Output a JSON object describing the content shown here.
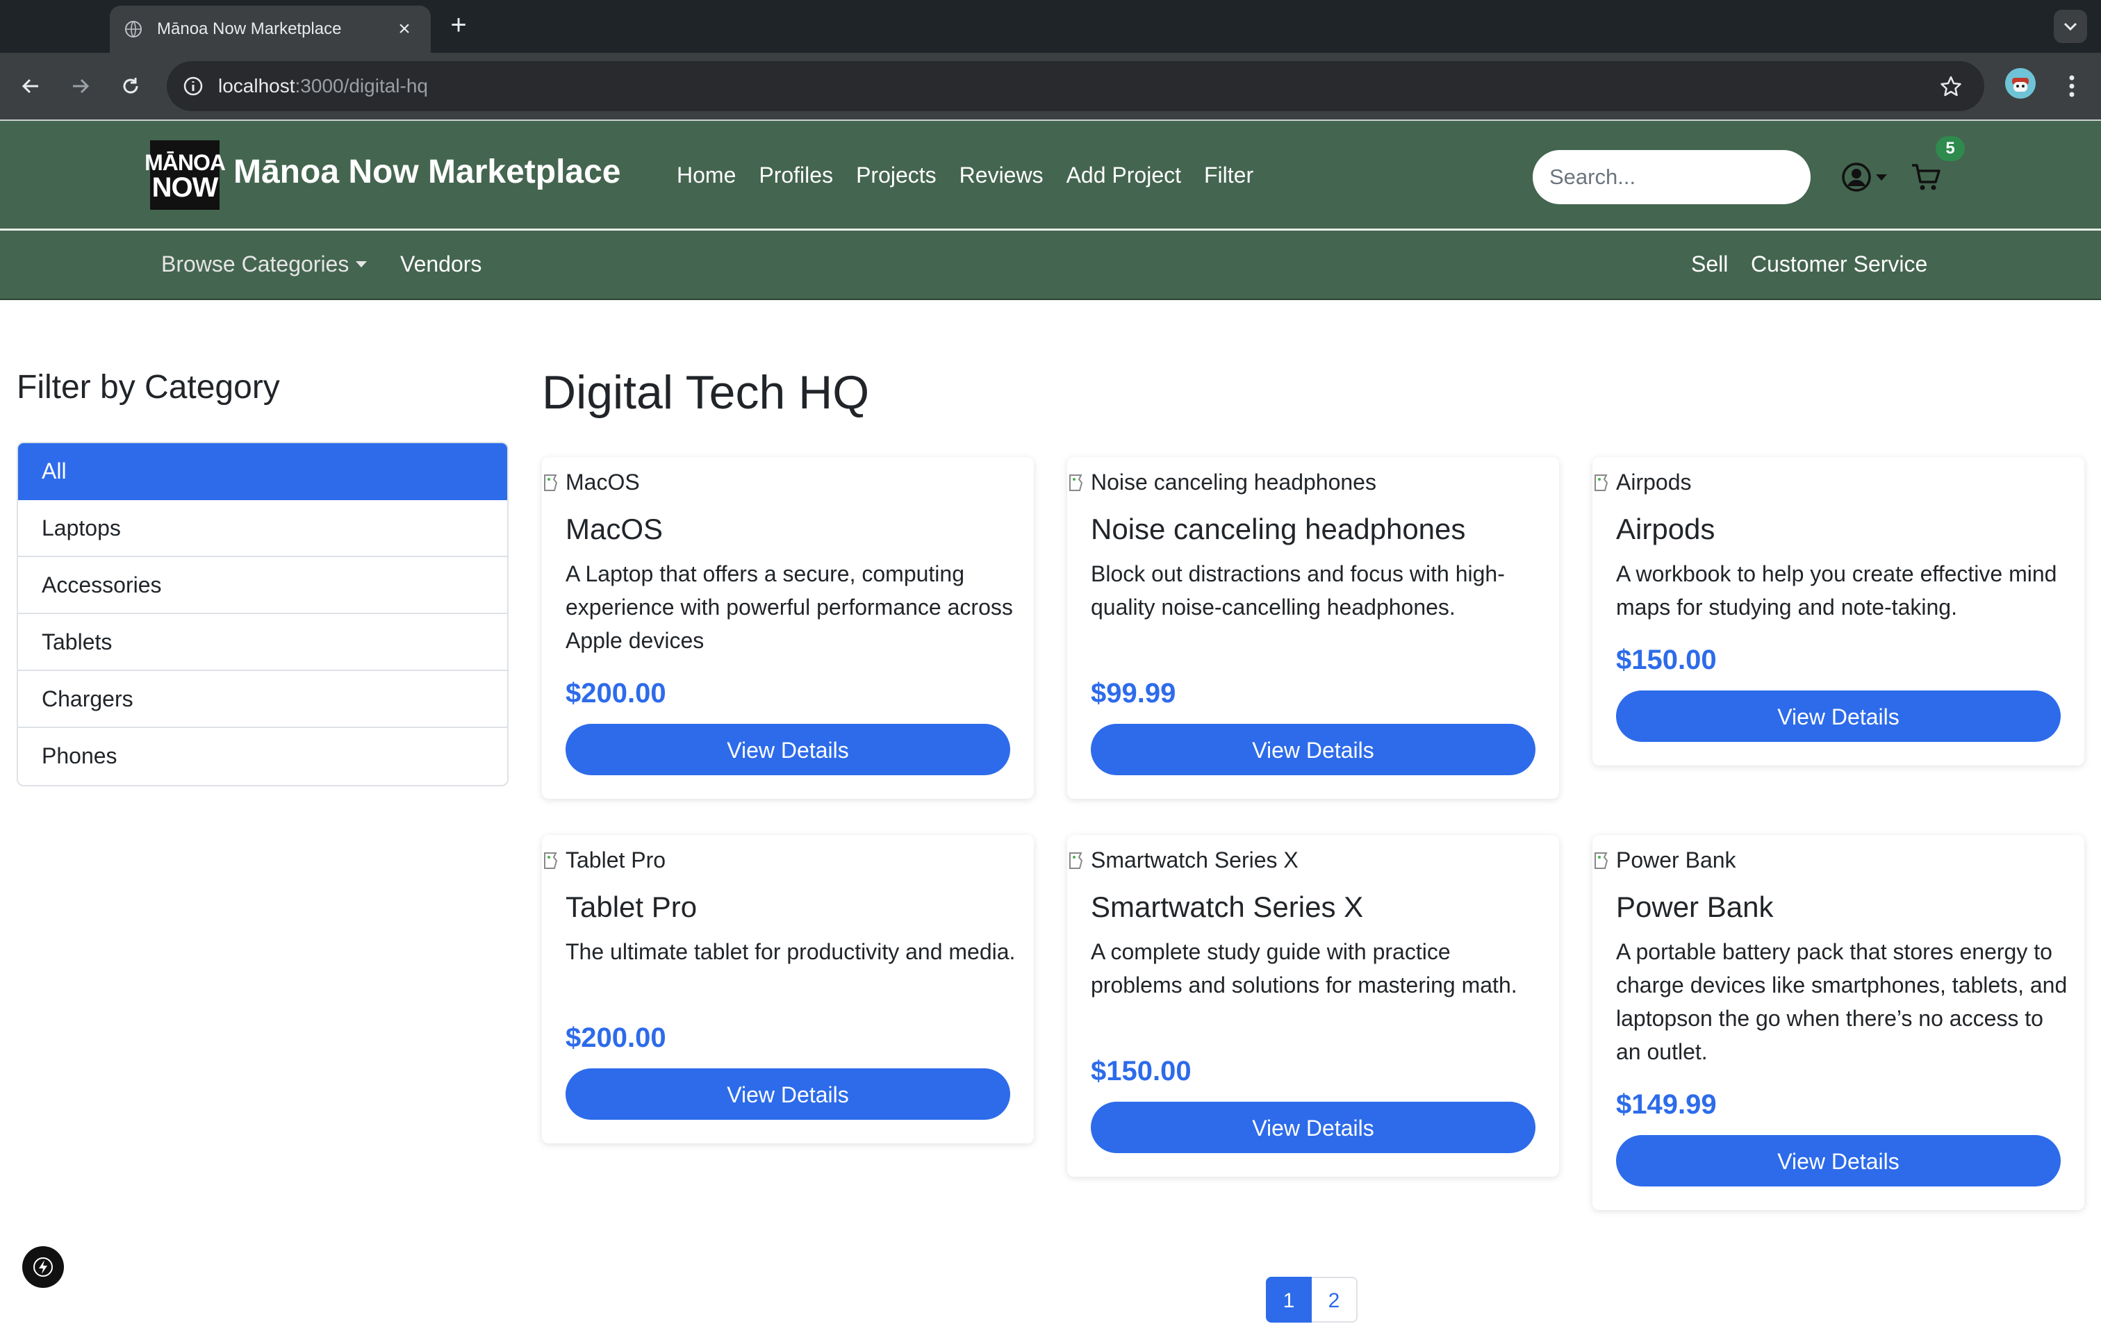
{
  "browser": {
    "tab_title": "Mānoa Now Marketplace",
    "url_host": "localhost",
    "url_path": ":3000/digital-hq"
  },
  "navbar": {
    "logo_line1": "MĀNOA",
    "logo_line2": "NOW",
    "brand": "Mānoa Now Marketplace",
    "links": [
      "Home",
      "Profiles",
      "Projects",
      "Reviews",
      "Add Project",
      "Filter"
    ],
    "search_placeholder": "Search...",
    "cart_count": "5"
  },
  "subnav": {
    "browse": "Browse Categories",
    "vendors": "Vendors",
    "sell": "Sell",
    "customer_service": "Customer Service"
  },
  "sidebar": {
    "title": "Filter by Category",
    "categories": [
      "All",
      "Laptops",
      "Accessories",
      "Tablets",
      "Chargers",
      "Phones"
    ],
    "active": "All"
  },
  "main": {
    "title": "Digital Tech HQ",
    "products": [
      {
        "img_alt": "MacOS",
        "title": "MacOS",
        "description": "A Laptop that offers a secure, computing experience with powerful performance across Apple devices",
        "price": "$200.00",
        "button": "View Details"
      },
      {
        "img_alt": "Noise canceling headphones",
        "title": "Noise canceling headphones",
        "description": "Block out distractions and focus with high-quality noise-cancelling headphones.",
        "price": "$99.99",
        "button": "View Details"
      },
      {
        "img_alt": "Airpods",
        "title": "Airpods",
        "description": "A workbook to help you create effective mind maps for studying and note-taking.",
        "price": "$150.00",
        "button": "View Details"
      },
      {
        "img_alt": "Tablet Pro",
        "title": "Tablet Pro",
        "description": "The ultimate tablet for productivity and media.",
        "price": "$200.00",
        "button": "View Details"
      },
      {
        "img_alt": "Smartwatch Series X",
        "title": "Smartwatch Series X",
        "description": "A complete study guide with practice problems and solutions for mastering math.",
        "price": "$150.00",
        "button": "View Details"
      },
      {
        "img_alt": "Power Bank",
        "title": "Power Bank",
        "description": "A portable battery pack that stores energy to charge devices like smartphones, tablets, and laptopson the go when there’s no access to an outlet.",
        "price": "$149.99",
        "button": "View Details"
      }
    ],
    "pagination": [
      "1",
      "2"
    ],
    "current_page": "1"
  },
  "colors": {
    "navbar_green": "#44654f",
    "primary_blue": "#2d6bea",
    "badge_green": "#2f8a4e"
  },
  "icons": [
    "globe-icon",
    "close-icon",
    "plus-icon",
    "chevron-down-icon",
    "back-arrow-icon",
    "forward-arrow-icon",
    "reload-icon",
    "info-icon",
    "star-icon",
    "kebab-menu-icon",
    "user-circle-icon",
    "cart-icon",
    "broken-image-icon",
    "bolt-icon"
  ]
}
